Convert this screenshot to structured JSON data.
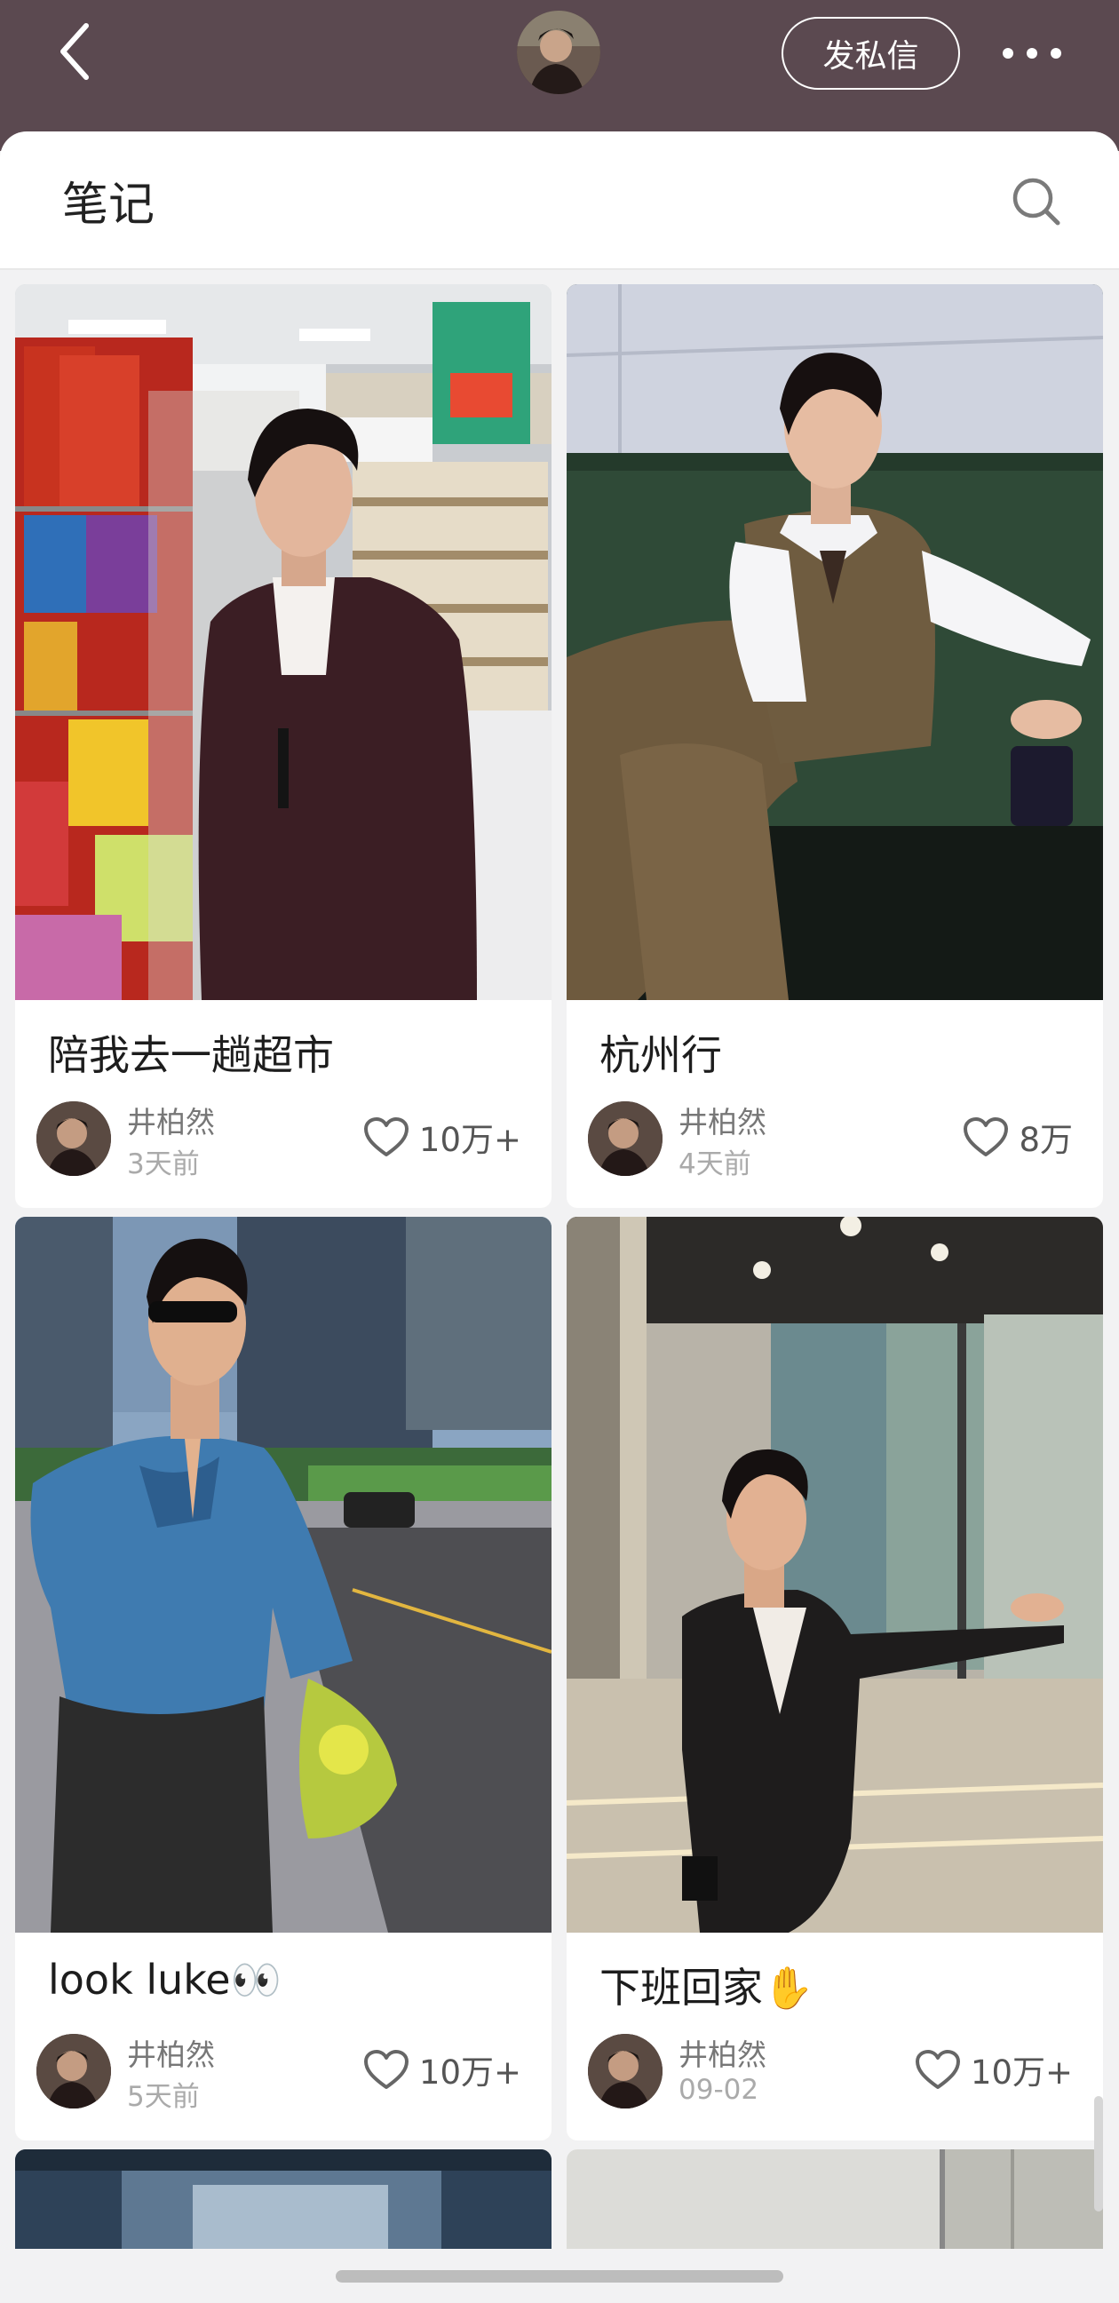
{
  "header": {
    "message_button_label": "发私信",
    "back_icon": "chevron-left-icon",
    "more_icon": "more-horizontal-icon"
  },
  "section": {
    "title": "笔记",
    "search_icon": "search-icon"
  },
  "notes": [
    {
      "title": "陪我去一趟超市",
      "author": "井柏然",
      "time": "3天前",
      "likes": "10万+"
    },
    {
      "title": "杭州行",
      "author": "井柏然",
      "time": "4天前",
      "likes": "8万"
    },
    {
      "title": "look luke👀",
      "author": "井柏然",
      "time": "5天前",
      "likes": "10万+"
    },
    {
      "title": "下班回家✋",
      "author": "井柏然",
      "time": "09-02",
      "likes": "10万+"
    }
  ],
  "colors": {
    "header_bg": "#5b4950",
    "page_bg": "#f2f2f3",
    "card_bg": "#ffffff"
  }
}
